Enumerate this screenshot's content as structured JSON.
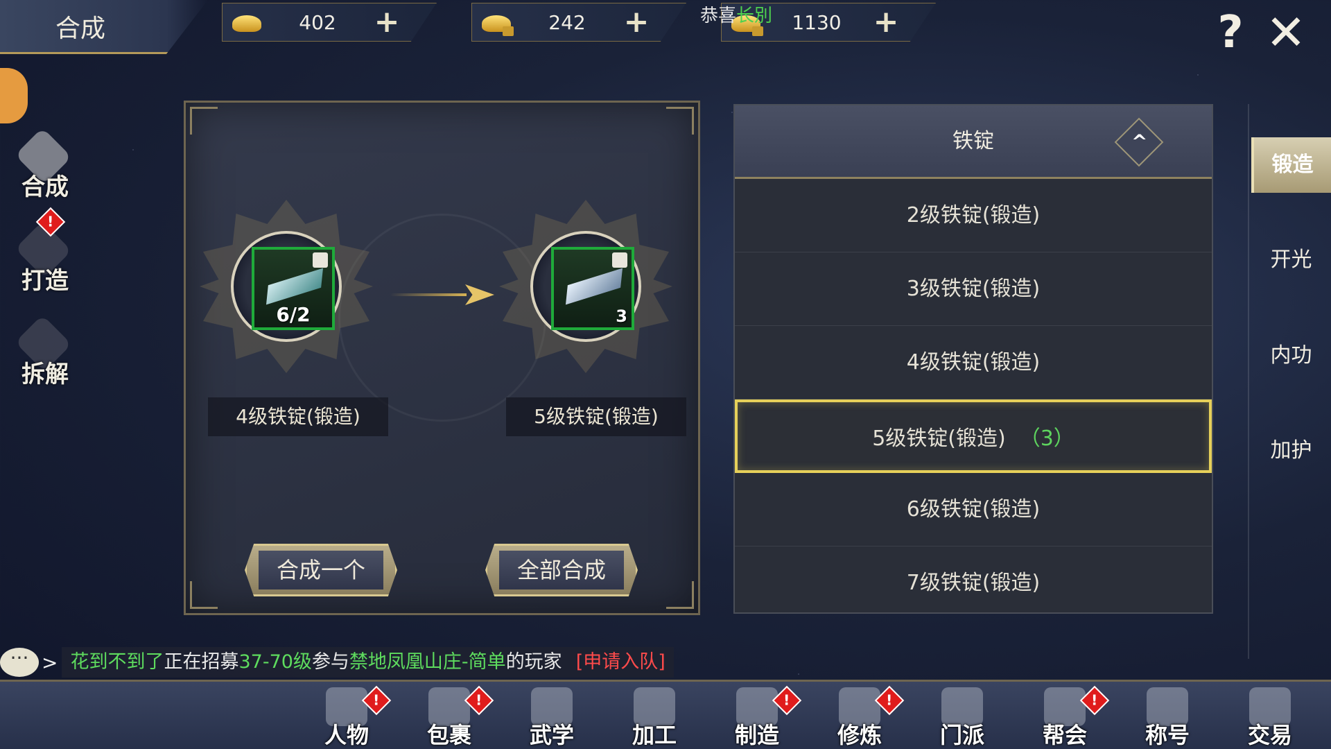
{
  "window": {
    "title": "合成"
  },
  "currencies": [
    {
      "icon": "gold-ingot-icon",
      "amount": "402",
      "locked": false
    },
    {
      "icon": "locked-gold-ingot-icon",
      "amount": "242",
      "locked": true
    },
    {
      "icon": "locked-silver-icon",
      "amount": "1130",
      "locked": true
    }
  ],
  "plus_label": "+",
  "congrats": {
    "prefix": "恭喜",
    "highlight": "长別"
  },
  "help_label": "?",
  "close_label": "✕",
  "left_nav": [
    {
      "label": "合成",
      "active": true,
      "badge": false
    },
    {
      "label": "打造",
      "active": false,
      "badge": true
    },
    {
      "label": "拆解",
      "active": false,
      "badge": false
    }
  ],
  "badge_mark": "!",
  "synthesis": {
    "source": {
      "name": "4级铁锭(锻造)",
      "count": "6/2"
    },
    "target": {
      "name": "5级铁锭(锻造)",
      "count": "3"
    },
    "btn_one": "合成一个",
    "btn_all": "全部合成"
  },
  "material_list": {
    "header": "铁锭",
    "collapse_glyph": "^",
    "items": [
      {
        "label": "2级铁锭(锻造)",
        "qty": ""
      },
      {
        "label": "3级铁锭(锻造)",
        "qty": ""
      },
      {
        "label": "4级铁锭(锻造)",
        "qty": ""
      },
      {
        "label": "5级铁锭(锻造)",
        "qty": "（3）",
        "selected": true
      },
      {
        "label": "6级铁锭(锻造)",
        "qty": ""
      },
      {
        "label": "7级铁锭(锻造)",
        "qty": ""
      }
    ]
  },
  "right_tabs": [
    {
      "label": "锻造",
      "active": true
    },
    {
      "label": "开光",
      "active": false
    },
    {
      "label": "内功",
      "active": false
    },
    {
      "label": "加护",
      "active": false
    }
  ],
  "chat": {
    "player": "花到不到了",
    "text1": "正在招募",
    "level_range": "37-70级",
    "text2": "参与",
    "dungeon": "禁地凤凰山庄-简单",
    "text3": "的玩家",
    "action": "[申请入队]"
  },
  "bottom_menu": [
    {
      "label": "人物",
      "icon": "character-icon",
      "badge": true
    },
    {
      "label": "包裹",
      "icon": "bag-icon",
      "badge": true
    },
    {
      "label": "武学",
      "icon": "martial-arts-icon",
      "badge": false
    },
    {
      "label": "加工",
      "icon": "hammer-icon",
      "badge": false
    },
    {
      "label": "制造",
      "icon": "gourd-icon",
      "badge": true
    },
    {
      "label": "修炼",
      "icon": "meditation-icon",
      "badge": true
    },
    {
      "label": "门派",
      "icon": "sect-gate-icon",
      "badge": false
    },
    {
      "label": "帮会",
      "icon": "guild-banner-icon",
      "badge": true
    },
    {
      "label": "称号",
      "icon": "title-token-icon",
      "badge": false
    },
    {
      "label": "交易",
      "icon": "scale-icon",
      "badge": false
    }
  ]
}
